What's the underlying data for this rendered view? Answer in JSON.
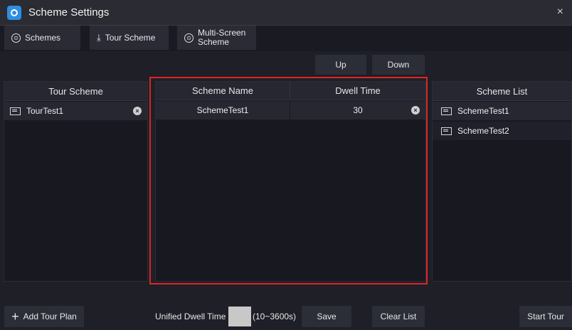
{
  "window": {
    "title": "Scheme Settings",
    "close_symbol": "×"
  },
  "tabs": [
    {
      "label": "Schemes",
      "icon": "circle-icon"
    },
    {
      "label": "Tour Scheme",
      "icon": "download-icon"
    },
    {
      "label_line1": "Multi-Screen",
      "label_line2": "Scheme",
      "icon": "circle-icon"
    }
  ],
  "order_buttons": {
    "up": "Up",
    "down": "Down"
  },
  "tour_panel": {
    "header": "Tour Scheme",
    "items": [
      {
        "name": "TourTest1"
      }
    ]
  },
  "scheme_table": {
    "headers": {
      "name": "Scheme Name",
      "dwell": "Dwell Time"
    },
    "rows": [
      {
        "name": "SchemeTest1",
        "dwell": "30"
      }
    ]
  },
  "scheme_list": {
    "header": "Scheme List",
    "items": [
      {
        "name": "SchemeTest1"
      },
      {
        "name": "SchemeTest2"
      }
    ]
  },
  "bottom": {
    "add_plan": "Add Tour Plan",
    "unified_label": "Unified Dwell Time",
    "unified_value": "",
    "unified_range": "(10~3600s)",
    "save": "Save",
    "clear": "Clear List",
    "start": "Start Tour"
  },
  "colors": {
    "accent": "#2f8ee0",
    "highlight_border": "#e02424",
    "background": "#1e1f27"
  }
}
